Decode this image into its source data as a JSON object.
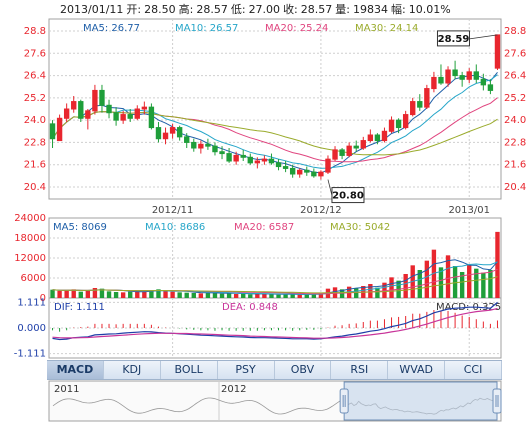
{
  "header": {
    "date": "2013/01/11",
    "open_label": "开:",
    "open": "28.50",
    "high_label": "高:",
    "high": "28.57",
    "low_label": "低:",
    "low": "27.00",
    "close_label": "收:",
    "close": "28.57",
    "volume_label": "量:",
    "volume": "19834",
    "change_label": "幅:",
    "change": "10.01%"
  },
  "price_ma": [
    {
      "label": "MA5: 26.77",
      "color": "#1f5fa8"
    },
    {
      "label": "MA10: 26.57",
      "color": "#26a6c9"
    },
    {
      "label": "MA20: 25.24",
      "color": "#e0457f"
    },
    {
      "label": "MA30: 24.14",
      "color": "#9aab2c"
    }
  ],
  "volume_ma": [
    {
      "label": "MA5: 8069",
      "color": "#1f5fa8"
    },
    {
      "label": "MA10: 8686",
      "color": "#26a6c9"
    },
    {
      "label": "MA20: 6587",
      "color": "#e0457f"
    },
    {
      "label": "MA30: 5042",
      "color": "#9aab2c"
    }
  ],
  "macd_labels": {
    "dif": "DIF: 1.111",
    "dif_color": "#1f3fa8",
    "dea": "DEA: 0.848",
    "dea_color": "#c8359a",
    "macd": "MACD: 0.325",
    "macd_color": "#333333"
  },
  "tabs": [
    "MACD",
    "KDJ",
    "BOLL",
    "PSY",
    "OBV",
    "RSI",
    "WVAD",
    "CCI"
  ],
  "active_tab": 0,
  "navigator": {
    "labels": [
      "2011",
      "2012"
    ]
  },
  "colors": {
    "up": "#e8262e",
    "down": "#1f9e3a",
    "grid": "#cfcfcf",
    "axis": "#a0a0a0"
  },
  "chart_data": [
    {
      "type": "candlestick",
      "y_ticks": [
        "28.8",
        "27.6",
        "26.4",
        "25.2",
        "24.0",
        "22.8",
        "21.6",
        "20.4"
      ],
      "ylim": [
        20.4,
        28.8
      ],
      "x_ticks": [
        {
          "label": "2012/11",
          "index": 17
        },
        {
          "label": "2012/12",
          "index": 38
        },
        {
          "label": "2013/01",
          "index": 59
        }
      ],
      "annotations": [
        {
          "text": "28.59",
          "index": 63,
          "value": 28.59
        },
        {
          "text": "20.80",
          "index": 39,
          "value": 20.8
        }
      ],
      "ohlc": [
        [
          23.8,
          24.0,
          22.5,
          23.0
        ],
        [
          22.9,
          24.3,
          22.9,
          24.1
        ],
        [
          24.1,
          24.9,
          23.9,
          24.6
        ],
        [
          24.6,
          25.3,
          24.4,
          25.0
        ],
        [
          25.0,
          25.1,
          23.9,
          24.1
        ],
        [
          24.1,
          24.6,
          23.5,
          24.5
        ],
        [
          24.5,
          25.9,
          24.3,
          25.6
        ],
        [
          25.6,
          25.9,
          24.4,
          24.8
        ],
        [
          24.8,
          25.1,
          24.1,
          24.4
        ],
        [
          24.4,
          24.7,
          23.7,
          24.0
        ],
        [
          24.0,
          24.5,
          23.8,
          24.3
        ],
        [
          24.3,
          24.6,
          23.9,
          24.1
        ],
        [
          24.1,
          24.8,
          24.0,
          24.6
        ],
        [
          24.6,
          25.0,
          24.3,
          24.7
        ],
        [
          24.7,
          24.9,
          23.5,
          23.6
        ],
        [
          23.6,
          23.9,
          22.8,
          23.0
        ],
        [
          23.0,
          23.6,
          22.7,
          23.3
        ],
        [
          23.3,
          23.8,
          23.0,
          23.6
        ],
        [
          23.6,
          23.7,
          22.9,
          23.1
        ],
        [
          23.1,
          23.3,
          22.5,
          22.8
        ],
        [
          22.8,
          23.0,
          22.3,
          22.5
        ],
        [
          22.5,
          22.9,
          22.2,
          22.7
        ],
        [
          22.7,
          23.0,
          22.4,
          22.6
        ],
        [
          22.6,
          22.8,
          22.1,
          22.3
        ],
        [
          22.3,
          22.6,
          21.9,
          22.2
        ],
        [
          22.2,
          22.5,
          21.7,
          21.8
        ],
        [
          21.8,
          22.3,
          21.6,
          22.1
        ],
        [
          22.1,
          22.4,
          21.8,
          22.0
        ],
        [
          22.0,
          22.2,
          21.6,
          21.7
        ],
        [
          21.7,
          22.0,
          21.4,
          21.8
        ],
        [
          21.8,
          22.1,
          21.6,
          21.9
        ],
        [
          21.9,
          22.2,
          21.6,
          21.7
        ],
        [
          21.7,
          21.9,
          21.3,
          21.5
        ],
        [
          21.5,
          21.8,
          21.2,
          21.4
        ],
        [
          21.4,
          21.6,
          20.9,
          21.1
        ],
        [
          21.1,
          21.4,
          20.9,
          21.3
        ],
        [
          21.3,
          21.5,
          21.0,
          21.2
        ],
        [
          21.2,
          21.4,
          20.9,
          21.0
        ],
        [
          21.0,
          21.3,
          20.8,
          21.2
        ],
        [
          21.2,
          22.1,
          21.1,
          21.9
        ],
        [
          21.9,
          22.6,
          21.8,
          22.4
        ],
        [
          22.4,
          22.5,
          21.9,
          22.1
        ],
        [
          22.1,
          22.8,
          22.0,
          22.6
        ],
        [
          22.6,
          22.9,
          22.3,
          22.5
        ],
        [
          22.5,
          23.1,
          22.4,
          22.9
        ],
        [
          22.9,
          23.5,
          22.8,
          23.2
        ],
        [
          23.2,
          23.3,
          22.7,
          22.9
        ],
        [
          22.9,
          23.6,
          22.8,
          23.4
        ],
        [
          23.4,
          24.2,
          23.3,
          24.0
        ],
        [
          24.0,
          24.1,
          23.3,
          23.6
        ],
        [
          23.6,
          24.5,
          23.5,
          24.3
        ],
        [
          24.3,
          25.2,
          24.2,
          25.0
        ],
        [
          25.0,
          25.4,
          24.5,
          24.7
        ],
        [
          24.7,
          25.9,
          24.6,
          25.7
        ],
        [
          25.7,
          26.6,
          25.5,
          26.3
        ],
        [
          26.3,
          27.0,
          25.9,
          26.0
        ],
        [
          26.0,
          26.9,
          25.8,
          26.7
        ],
        [
          26.7,
          27.2,
          26.2,
          26.4
        ],
        [
          26.4,
          26.6,
          25.8,
          26.2
        ],
        [
          26.2,
          26.8,
          26.0,
          26.6
        ],
        [
          26.6,
          27.0,
          26.0,
          26.2
        ],
        [
          26.2,
          26.5,
          25.6,
          25.9
        ],
        [
          25.9,
          26.2,
          25.4,
          25.6
        ],
        [
          26.8,
          28.59,
          26.7,
          28.59
        ]
      ]
    },
    {
      "type": "bar",
      "y_ticks": [
        "24000",
        "18000",
        "12000",
        "6000",
        "0"
      ],
      "ylim": [
        0,
        24000
      ],
      "values": [
        2500,
        2100,
        2300,
        2600,
        1900,
        2200,
        3000,
        2800,
        2000,
        1800,
        1700,
        1900,
        2100,
        2000,
        2300,
        2600,
        2200,
        1900,
        1700,
        1600,
        1500,
        1400,
        1600,
        1500,
        1300,
        1400,
        1200,
        1300,
        1100,
        1200,
        1300,
        1100,
        1000,
        1100,
        1200,
        1000,
        1100,
        1200,
        1400,
        2800,
        3200,
        2600,
        3400,
        2900,
        3600,
        4200,
        3100,
        4600,
        6200,
        5200,
        7200,
        9800,
        8400,
        11200,
        14500,
        9200,
        12800,
        9600,
        7800,
        9900,
        8800,
        7600,
        8400,
        19834
      ]
    },
    {
      "type": "line",
      "y_ticks": [
        "1.111",
        "0.000",
        "-1.111"
      ],
      "ylim": [
        -1.3,
        1.3
      ],
      "dif": [
        -0.45,
        -0.5,
        -0.48,
        -0.42,
        -0.4,
        -0.38,
        -0.3,
        -0.28,
        -0.26,
        -0.25,
        -0.22,
        -0.2,
        -0.18,
        -0.16,
        -0.17,
        -0.2,
        -0.22,
        -0.23,
        -0.25,
        -0.27,
        -0.29,
        -0.31,
        -0.32,
        -0.34,
        -0.35,
        -0.37,
        -0.38,
        -0.39,
        -0.41,
        -0.42,
        -0.42,
        -0.43,
        -0.44,
        -0.45,
        -0.47,
        -0.47,
        -0.47,
        -0.48,
        -0.47,
        -0.43,
        -0.38,
        -0.35,
        -0.3,
        -0.26,
        -0.2,
        -0.14,
        -0.1,
        -0.03,
        0.06,
        0.12,
        0.2,
        0.32,
        0.4,
        0.52,
        0.66,
        0.74,
        0.82,
        0.86,
        0.87,
        0.9,
        0.9,
        0.88,
        0.86,
        1.111
      ],
      "dea": [
        -0.4,
        -0.42,
        -0.43,
        -0.43,
        -0.42,
        -0.41,
        -0.39,
        -0.37,
        -0.35,
        -0.33,
        -0.31,
        -0.29,
        -0.27,
        -0.25,
        -0.24,
        -0.23,
        -0.23,
        -0.23,
        -0.24,
        -0.24,
        -0.25,
        -0.26,
        -0.27,
        -0.28,
        -0.3,
        -0.31,
        -0.32,
        -0.33,
        -0.35,
        -0.36,
        -0.37,
        -0.38,
        -0.39,
        -0.4,
        -0.41,
        -0.42,
        -0.43,
        -0.44,
        -0.44,
        -0.44,
        -0.43,
        -0.41,
        -0.39,
        -0.36,
        -0.33,
        -0.3,
        -0.26,
        -0.22,
        -0.17,
        -0.12,
        -0.06,
        0.01,
        0.09,
        0.17,
        0.27,
        0.36,
        0.45,
        0.53,
        0.6,
        0.66,
        0.71,
        0.74,
        0.77,
        0.848
      ],
      "macd": [
        -0.1,
        -0.16,
        -0.1,
        0.02,
        0.04,
        0.06,
        0.18,
        0.18,
        0.18,
        0.16,
        0.18,
        0.18,
        0.18,
        0.18,
        0.14,
        0.06,
        0.02,
        0.0,
        -0.02,
        -0.06,
        -0.08,
        -0.1,
        -0.1,
        -0.12,
        -0.1,
        -0.12,
        -0.12,
        -0.12,
        -0.12,
        -0.12,
        -0.1,
        -0.1,
        -0.1,
        -0.1,
        -0.12,
        -0.1,
        -0.08,
        -0.08,
        -0.06,
        0.02,
        0.1,
        0.12,
        0.18,
        0.2,
        0.26,
        0.32,
        0.32,
        0.38,
        0.46,
        0.48,
        0.52,
        0.62,
        0.62,
        0.7,
        0.78,
        0.76,
        0.74,
        0.66,
        0.54,
        0.48,
        0.38,
        0.28,
        0.18,
        0.325
      ]
    }
  ]
}
